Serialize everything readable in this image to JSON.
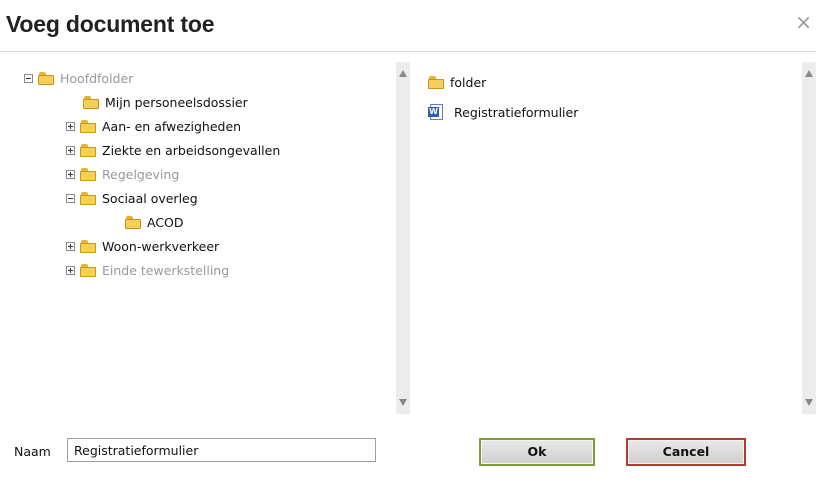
{
  "dialog": {
    "title": "Voeg document toe",
    "close_glyph": "×"
  },
  "tree": {
    "items": [
      {
        "label": "Hoofdfolder",
        "expander": "minus",
        "muted": true,
        "icon": "folder-icon"
      },
      {
        "label": "Mijn personeelsdossier",
        "expander": null,
        "muted": false,
        "icon": "folder-icon"
      },
      {
        "label": "Aan- en afwezigheden",
        "expander": "plus",
        "muted": false,
        "icon": "folder-icon"
      },
      {
        "label": "Ziekte en arbeidsongevallen",
        "expander": "plus",
        "muted": false,
        "icon": "folder-icon"
      },
      {
        "label": "Regelgeving",
        "expander": "plus",
        "muted": true,
        "icon": "folder-icon"
      },
      {
        "label": "Sociaal overleg",
        "expander": "minus",
        "muted": false,
        "icon": "folder-icon"
      },
      {
        "label": "ACOD",
        "expander": null,
        "muted": false,
        "icon": "folder-icon"
      },
      {
        "label": "Woon-werkverkeer",
        "expander": "plus",
        "muted": false,
        "icon": "folder-icon"
      },
      {
        "label": "Einde tewerkstelling",
        "expander": "plus",
        "muted": true,
        "icon": "folder-icon"
      }
    ]
  },
  "files": {
    "items": [
      {
        "label": "folder",
        "icon": "folder-icon"
      },
      {
        "label": "Registratieformulier",
        "icon": "word-document-icon",
        "badge": "W"
      }
    ]
  },
  "footer": {
    "name_label": "Naam",
    "name_value": "Registratieformulier",
    "ok_label": "Ok",
    "cancel_label": "Cancel"
  },
  "colors": {
    "ok_border": "#7e9d3a",
    "cancel_border": "#b13d2f",
    "folder": "#f4cf5b",
    "muted_text": "#999999"
  }
}
